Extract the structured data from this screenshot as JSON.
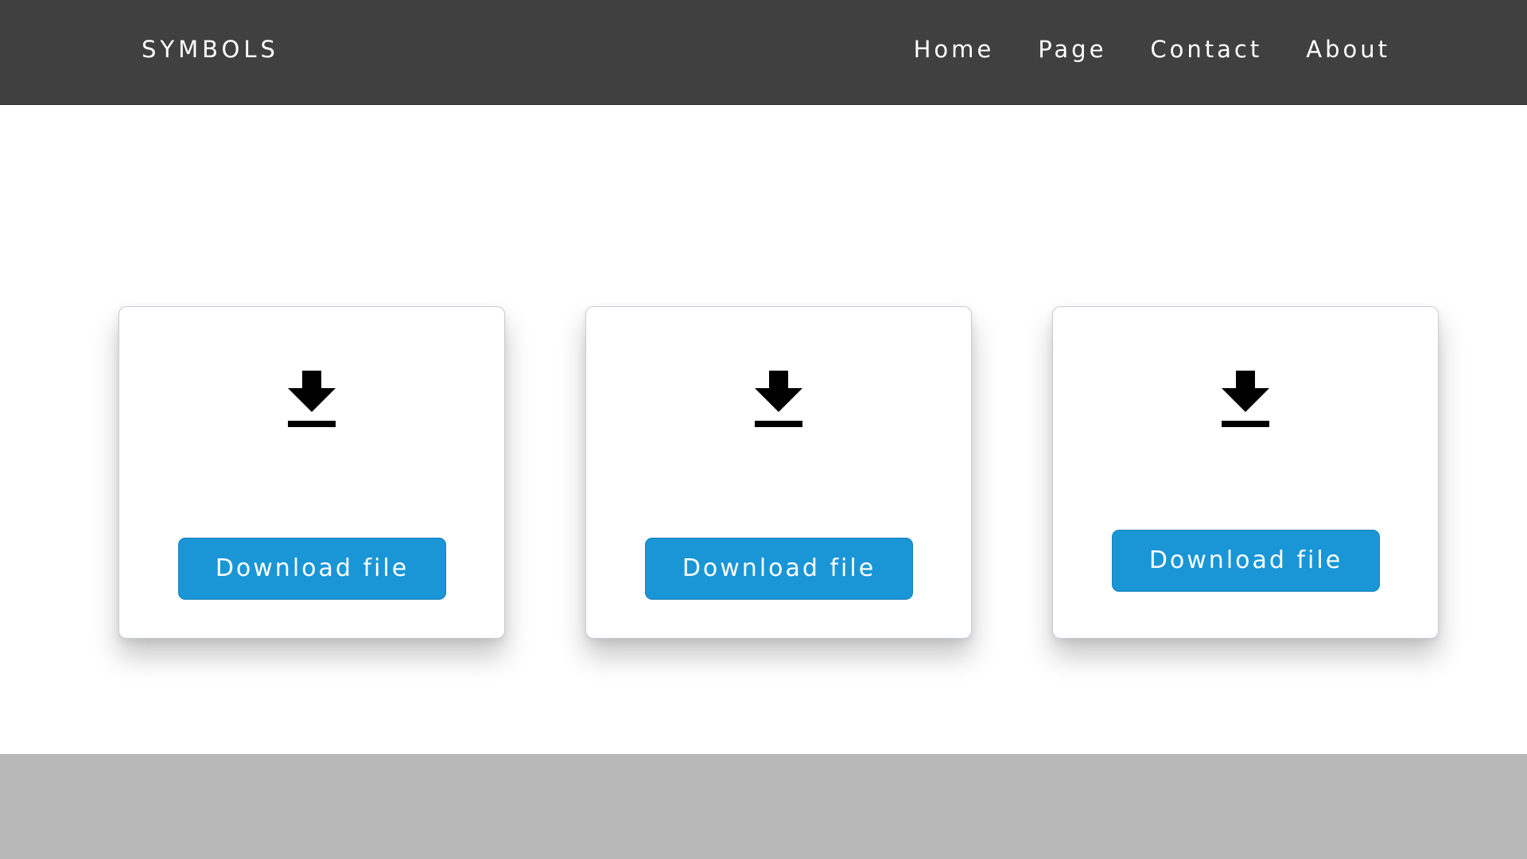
{
  "header": {
    "brand": "SYMBOLS",
    "nav": [
      "Home",
      "Page",
      "Contact",
      "About"
    ]
  },
  "cards": [
    {
      "icon": "download-icon",
      "button_label": "Download file"
    },
    {
      "icon": "download-icon",
      "button_label": "Download file"
    },
    {
      "icon": "download-icon",
      "button_label": "Download file"
    }
  ],
  "colors": {
    "header_bg": "#404040",
    "button_bg": "#1a96d6",
    "footer_bg": "#b8b8b8"
  }
}
